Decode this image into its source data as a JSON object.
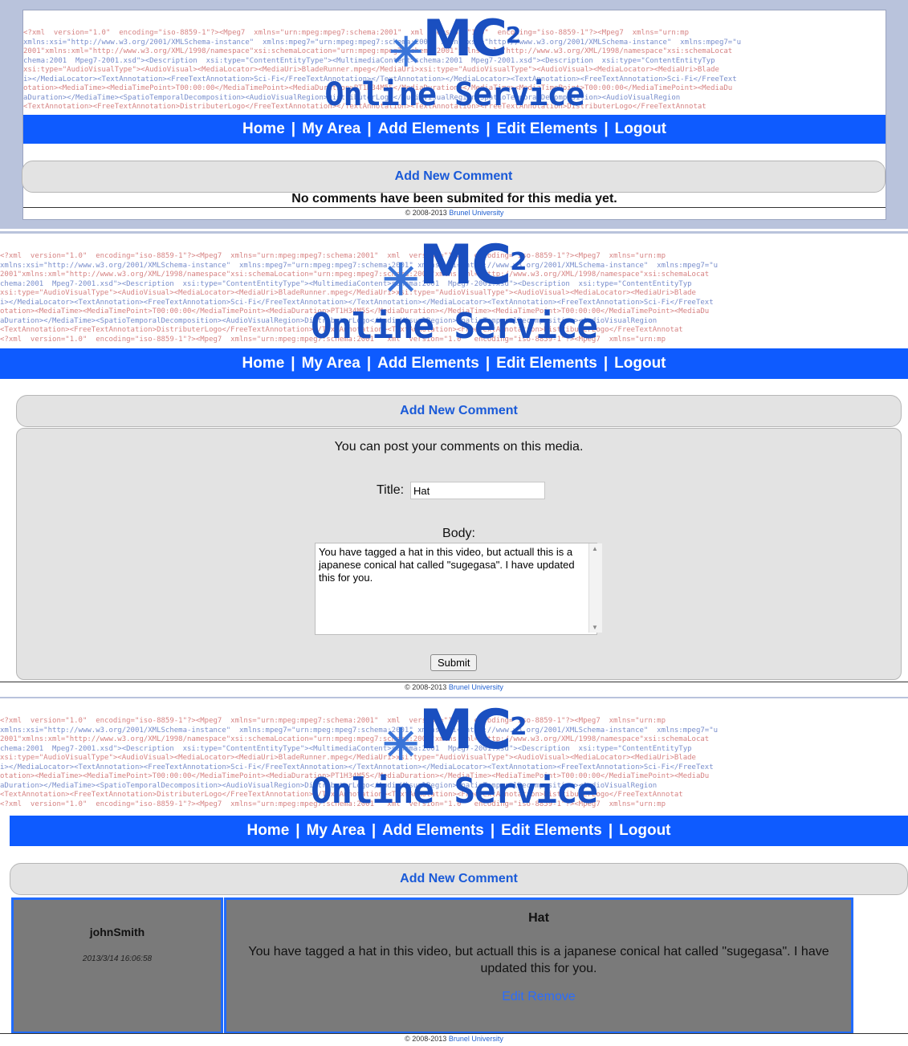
{
  "logo": {
    "mc": "MC",
    "sup": "2",
    "service": "Online Service"
  },
  "xml_background": [
    "<?xml  version=\"1.0\"  encoding=\"iso-8859-1\"?><Mpeg7  xmlns=\"urn:mpeg:mpeg7:schema:2001\"  xml  version=\"1.0\"  encoding=\"iso-8859-1\"?><Mpeg7  xmlns=\"urn:mp",
    "xmlns:xsi=\"http://www.w3.org/2001/XMLSchema-instance\"  xmlns:mpeg7=\"urn:mpeg:mpeg7:schema:2001\" xmlns:xsi=\"http://www.w3.org/2001/XMLSchema-instance\"  xmlns:mpeg7=\"u",
    "2001\"xmlns:xml=\"http://www.w3.org/XML/1998/namespace\"xsi:schemaLocation=\"urn:mpeg:mpeg7:schema:2001\"xmlns:xml=\"http://www.w3.org/XML/1998/namespace\"xsi:schemaLocat",
    "chema:2001  Mpeg7-2001.xsd\"><Description  xsi:type=\"ContentEntityType\"><MultimediaContent>schema:2001  Mpeg7-2001.xsd\"><Description  xsi:type=\"ContentEntityTyp",
    "xsi:type=\"AudioVisualType\"><AudioVisual><MediaLocator><MediaUri>BladeRunner.mpeg</MediaUri>xsi:type=\"AudioVisualType\"><AudioVisual><MediaLocator><MediaUri>Blade",
    "i></MediaLocator><TextAnnotation><FreeTextAnnotation>Sci-Fi</FreeTextAnnotation></TextAnnotation></MediaLocator><TextAnnotation><FreeTextAnnotation>Sci-Fi</FreeText",
    "otation><MediaTime><MediaTimePoint>T00:00:00</MediaTimePoint><MediaDuration>PT1H34M5S</MediaDuration></MediaTime><MediaTimePoint>T00:00:00</MediaTimePoint><MediaDu",
    "aDuration></MediaTime><SpatioTemporalDecomposition><AudioVisualRegion>DistributerLogo</AudioVisualRegion>SpatioTemporalDecomposition><AudioVisualRegion",
    "<TextAnnotation><FreeTextAnnotation>DistributerLogo</FreeTextAnnotation></TextAnnotation><TextAnnotation><FreeTextAnnotation>DistributerLogo</FreeTextAnnotat"
  ],
  "nav": {
    "home": "Home",
    "my_area": "My Area",
    "add_elements": "Add Elements",
    "edit_elements": "Edit Elements",
    "logout": "Logout",
    "separator": "|"
  },
  "add_comment_label": "Add New Comment",
  "panel1": {
    "no_comments": "No comments have been submited for this media yet."
  },
  "form": {
    "intro": "You can post your comments on this media.",
    "title_label": "Title:",
    "title_value": "Hat",
    "body_label": "Body:",
    "body_value": "You have tagged a hat in this video, but actuall this is a japanese conical hat called \"sugegasa\". I have updated this for you.",
    "submit_label": "Submit"
  },
  "comment": {
    "author": "johnSmith",
    "date": "2013/3/14 16:06:58",
    "title": "Hat",
    "text": "You have tagged a hat in this video, but actuall this is a japanese conical hat called \"sugegasa\". I have updated this for you.",
    "edit_label": "Edit",
    "remove_label": "Remove"
  },
  "footer": {
    "copyright": "© 2008-2013",
    "org": "Brunel University"
  },
  "colors": {
    "nav_blue": "#0e5bff",
    "logo_blue": "#1a4fc0",
    "link_blue": "#1a5ad8",
    "comment_gray": "#7a7a7a"
  }
}
